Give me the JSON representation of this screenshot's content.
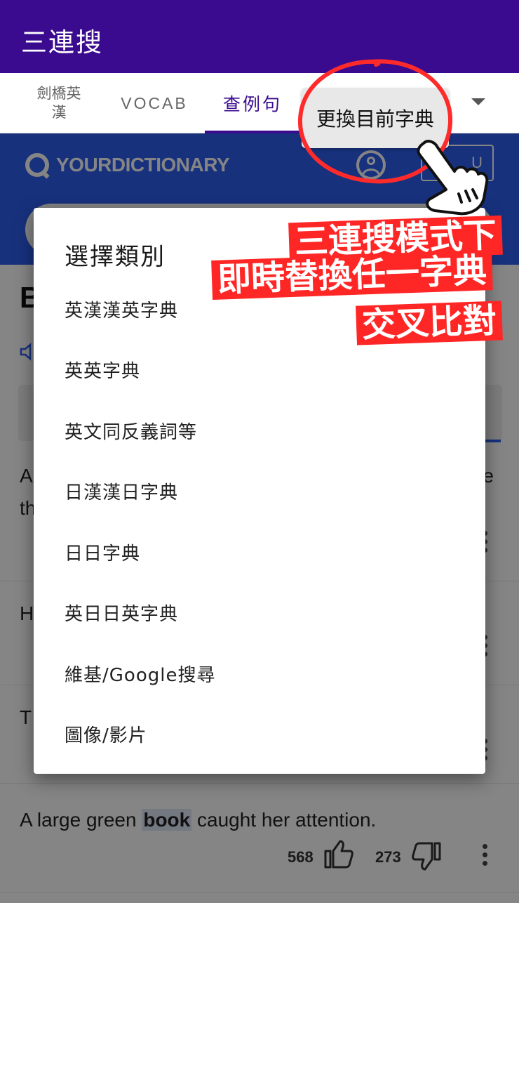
{
  "app": {
    "title": "三連搜"
  },
  "tabs": [
    {
      "label": "劍橋英\n漢"
    },
    {
      "label": "VOCAB"
    },
    {
      "label": "查例句"
    }
  ],
  "switch_dict_label": "更換目前字典",
  "dictionary": {
    "logo_text": "YOURDICTIONARY",
    "menu_label": "U",
    "word_initial": "B"
  },
  "examples": [
    {
      "start": "A",
      "end": "e",
      "line2_start": "th"
    },
    {
      "start": "H"
    },
    {
      "start": "T"
    },
    {
      "before": "A large green ",
      "keyword": "book",
      "after": " caught her attention.",
      "upvotes": "568",
      "downvotes": "273"
    }
  ],
  "dialog": {
    "title": "選擇類別",
    "options": [
      "英漢漢英字典",
      "英英字典",
      "英文同反義詞等",
      "日漢漢日字典",
      "日日字典",
      "英日日英字典",
      "維基/Google搜尋",
      "圖像/影片"
    ]
  },
  "annotation": {
    "line1": "三連搜模式下",
    "line2": "即時替換任一字典",
    "line3": "交叉比對"
  },
  "colors": {
    "app_bar": "#3a0a8f",
    "dict_header": "#2d5ff0",
    "annotation_red": "#ff2626"
  }
}
